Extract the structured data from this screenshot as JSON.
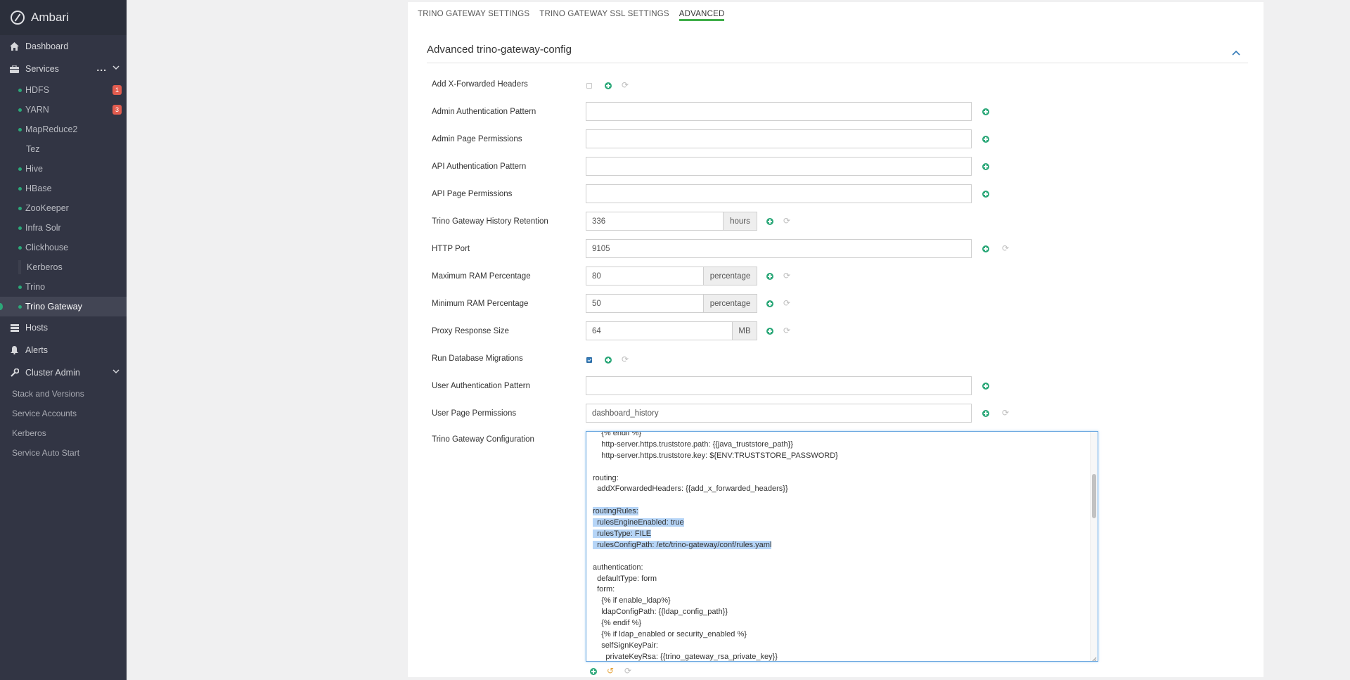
{
  "app": {
    "title": "Ambari"
  },
  "sidebar": {
    "nav": [
      {
        "label": "Dashboard",
        "icon": "home-icon"
      },
      {
        "label": "Services",
        "icon": "briefcase-icon",
        "menu": "..."
      },
      {
        "label": "Hosts",
        "icon": "server-icon"
      },
      {
        "label": "Alerts",
        "icon": "bell-icon"
      },
      {
        "label": "Cluster Admin",
        "icon": "wrench-icon"
      }
    ],
    "services": [
      {
        "label": "HDFS",
        "badge": "1"
      },
      {
        "label": "YARN",
        "badge": "3"
      },
      {
        "label": "MapReduce2"
      },
      {
        "label": "Tez"
      },
      {
        "label": "Hive"
      },
      {
        "label": "HBase"
      },
      {
        "label": "ZooKeeper"
      },
      {
        "label": "Infra Solr"
      },
      {
        "label": "Clickhouse"
      },
      {
        "label": "Kerberos"
      },
      {
        "label": "Trino"
      },
      {
        "label": "Trino Gateway"
      }
    ],
    "cluster_admin": [
      "Stack and Versions",
      "Service Accounts",
      "Kerberos",
      "Service Auto Start"
    ]
  },
  "tabs": [
    "TRINO GATEWAY SETTINGS",
    "TRINO GATEWAY SSL SETTINGS",
    "ADVANCED"
  ],
  "section": {
    "title": "Advanced trino-gateway-config"
  },
  "fields": [
    {
      "label": "Add X-Forwarded Headers"
    },
    {
      "label": "Admin Authentication Pattern",
      "value": ""
    },
    {
      "label": "Admin Page Permissions",
      "value": ""
    },
    {
      "label": "API Authentication Pattern",
      "value": ""
    },
    {
      "label": "API Page Permissions",
      "value": ""
    },
    {
      "label": "Trino Gateway History Retention",
      "value": "336",
      "unit": "hours"
    },
    {
      "label": "HTTP Port",
      "value": "9105"
    },
    {
      "label": "Maximum RAM Percentage",
      "value": "80",
      "unit": "percentage"
    },
    {
      "label": "Minimum RAM Percentage",
      "value": "50",
      "unit": "percentage"
    },
    {
      "label": "Proxy Response Size",
      "value": "64",
      "unit": "MB"
    },
    {
      "label": "Run Database Migrations"
    },
    {
      "label": "User Authentication Pattern",
      "value": ""
    },
    {
      "label": "User Page Permissions",
      "value": "dashboard_history"
    },
    {
      "label": "Trino Gateway Configuration"
    }
  ],
  "config_text": [
    "    {% endif %}",
    "    http-server.https.truststore.path: {{java_truststore_path}}",
    "    http-server.https.truststore.key: ${ENV:TRUSTSTORE_PASSWORD}",
    "",
    "routing:",
    "  addXForwardedHeaders: {{add_x_forwarded_headers}}",
    "",
    "routingRules:",
    "  rulesEngineEnabled: true",
    "  rulesType: FILE",
    "  rulesConfigPath: /etc/trino-gateway/conf/rules.yaml",
    "",
    "authentication:",
    "  defaultType: form",
    "  form:",
    "    {% if enable_ldap%}",
    "    ldapConfigPath: {{ldap_config_path}}",
    "    {% endif %}",
    "    {% if ldap_enabled or security_enabled %}",
    "    selfSignKeyPair:",
    "      privateKeyRsa: {{trino_gateway_rsa_private_key}}"
  ],
  "colors": {
    "sidebar": "#323544",
    "accent": "#3fae49",
    "plus": "#2ca879",
    "badge": "#e25c4f"
  }
}
